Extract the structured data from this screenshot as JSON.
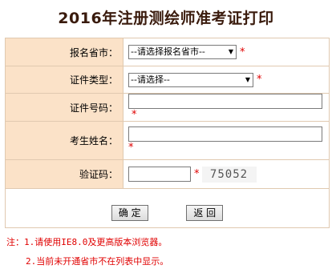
{
  "title": "2016年注册测绘师准考证打印",
  "form": {
    "province_label": "报名省市：",
    "province_value": "--请选择报名省市--",
    "id_type_label": "证件类型：",
    "id_type_value": "--请选择--",
    "id_number_label": "证件号码：",
    "id_number_value": "",
    "name_label": "考生姓名：",
    "name_value": "",
    "captcha_label": "验证码：",
    "captcha_value": "",
    "captcha_image_text": "75052",
    "required_mark": "*"
  },
  "buttons": {
    "confirm": "确 定",
    "back": "返 回"
  },
  "notes": {
    "line1": "注：1.请使用IE8.0及更高版本浏览器。",
    "line2": "2.当前未开通省市不在列表中显示。"
  },
  "colors": {
    "label_bg": "#fbe2c8",
    "border": "#e0c9b0",
    "required": "#e00000",
    "title": "#3a1b0d"
  }
}
